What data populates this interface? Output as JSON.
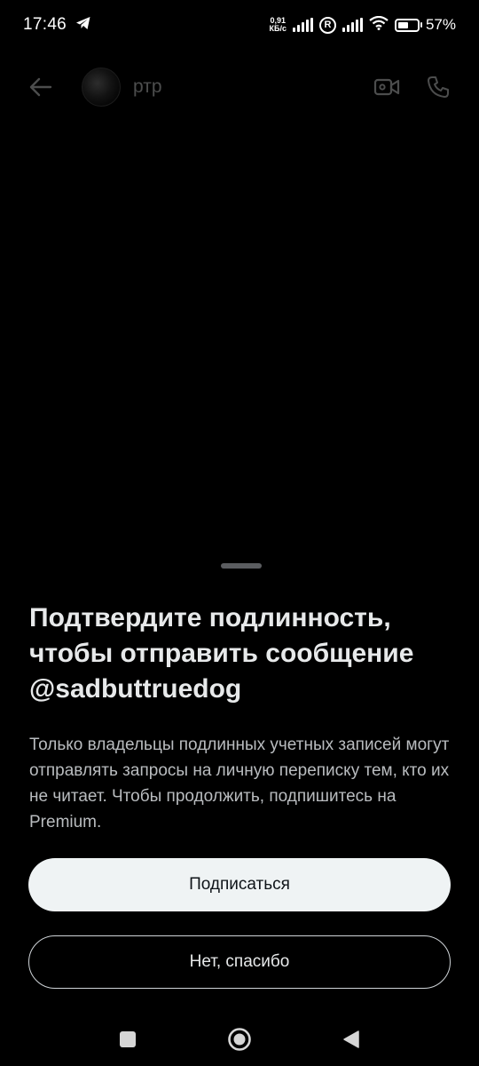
{
  "status_bar": {
    "time": "17:46",
    "net_speed_value": "0,91",
    "net_speed_unit": "КБ/с",
    "roaming_badge": "R",
    "battery_percent": "57%",
    "battery_level": 0.57,
    "icons": [
      "telegram-icon",
      "signal-icon",
      "roaming-icon",
      "signal-icon",
      "wifi-icon",
      "battery-icon"
    ]
  },
  "header": {
    "contact_name": "ртр",
    "icons": [
      "back-arrow-icon",
      "video-call-icon",
      "phone-icon"
    ]
  },
  "sheet": {
    "title_line1": "Подтвердите подлинность,",
    "title_line2": "чтобы отправить сообщение",
    "title_line3": "@sadbuttruedog",
    "body": "Только владельцы подлинных учетных записей могут отправлять запросы на личную переписку тем, кто их не читает. Чтобы продолжить, подпишитесь на Premium.",
    "subscribe_label": "Подписаться",
    "decline_label": "Нет, спасибо"
  },
  "nav_bar": {
    "icons": [
      "recents-square-icon",
      "home-circle-icon",
      "back-triangle-icon"
    ]
  },
  "colors": {
    "background": "#000000",
    "primary_button": "#eff3f4",
    "text": "#e7e9ea",
    "muted_text": "#b9bcbf"
  }
}
